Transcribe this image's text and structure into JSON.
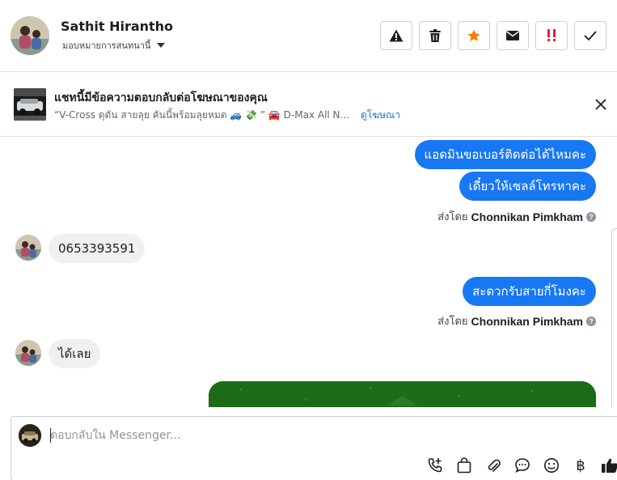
{
  "header": {
    "contact_name": "Sathit Hirantho",
    "assign_label": "มอบหมายการสนทนานี้",
    "actions": [
      {
        "name": "report-spam-button",
        "icon": "warning-icon",
        "color": "#1c1e21"
      },
      {
        "name": "delete-button",
        "icon": "trash-icon",
        "color": "#1c1e21"
      },
      {
        "name": "star-button",
        "icon": "star-icon",
        "color": "#f57c00"
      },
      {
        "name": "mark-unread-button",
        "icon": "envelope-icon",
        "color": "#1c1e21"
      },
      {
        "name": "follow-up-button",
        "icon": "double-exclamation-icon",
        "color": "#e41e3f"
      },
      {
        "name": "mark-done-button",
        "icon": "checkmark-icon",
        "color": "#1c1e21"
      }
    ]
  },
  "ad_banner": {
    "title": "แชทนี้มีข้อความตอบกลับต่อโฆษณาของคุณ",
    "subtitle": "“V-Cross ดุดัน สายลุย คันนี้พร้อมลุยหมด 🚙 💸 ” 🚘 D-Max All New Bl...",
    "link": "ดูโฆษณา"
  },
  "messages": [
    {
      "direction": "out",
      "text": "แอดมินขอเบอร์ติดต่อได้ไหมคะ"
    },
    {
      "direction": "out",
      "text": "เดี๋ยวให้เซลล์โทรหาคะ"
    },
    {
      "direction": "in",
      "text": "0653393591"
    },
    {
      "direction": "out",
      "text": "สะดวกรับสายกี่โมงคะ"
    },
    {
      "direction": "in",
      "text": "ได้เลย"
    }
  ],
  "sent_by": {
    "prefix": "ส่งโดย",
    "name": "Chonnikan Pimkham",
    "help": "?"
  },
  "composer": {
    "placeholder": "ตอบกลับใน Messenger...",
    "value": "",
    "tools": [
      "call-add-icon",
      "shopping-bag-icon",
      "paperclip-icon",
      "chat-bubble-icon",
      "emoji-icon",
      "baht-icon",
      "thumbs-up-icon"
    ],
    "baht_symbol": "฿"
  },
  "colors": {
    "accent": "#1877f2",
    "incoming_bubble": "#f0f0f0",
    "link": "#216fdb",
    "star": "#f57c00",
    "alert": "#e41e3f"
  }
}
